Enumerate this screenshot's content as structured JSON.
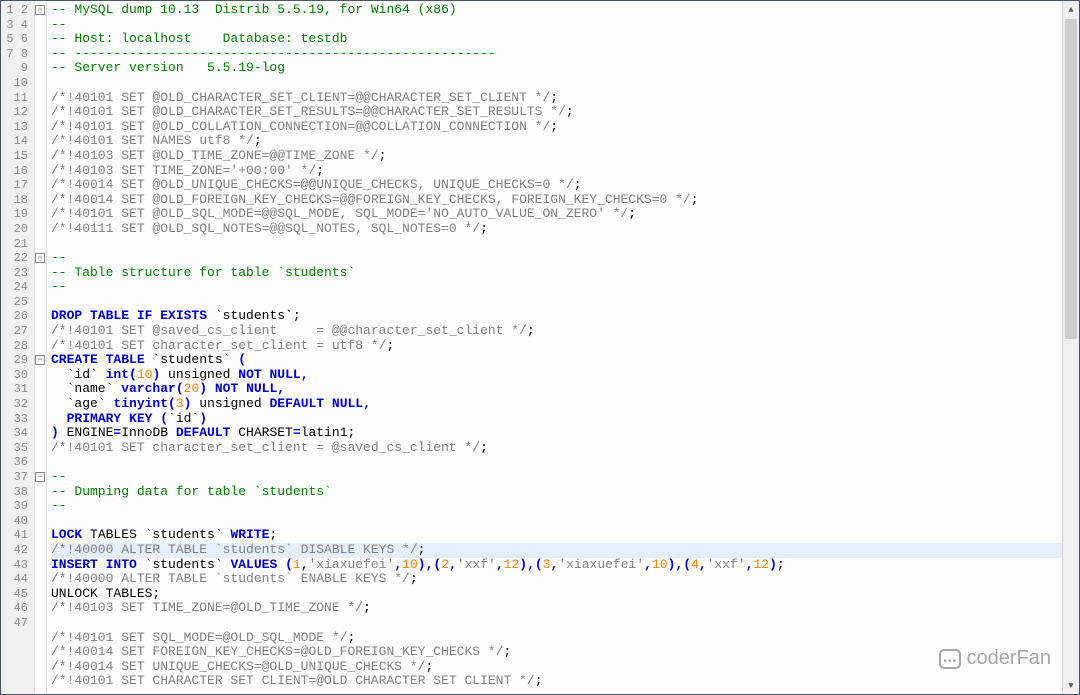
{
  "lineCount": 47,
  "highlightLine": 38,
  "foldMarks": [
    {
      "line": 1,
      "sym": "−"
    },
    {
      "line": 18,
      "sym": "−"
    },
    {
      "line": 25,
      "sym": "−"
    },
    {
      "line": 33,
      "sym": "−"
    }
  ],
  "watermark": "coderFan",
  "lines": {
    "l1": [
      [
        "c-comment",
        "-- MySQL dump 10.13  Distrib 5.5.19, for Win64 (x86)"
      ]
    ],
    "l2": [
      [
        "c-comment",
        "--"
      ]
    ],
    "l3": [
      [
        "c-comment",
        "-- Host: localhost    Database: testdb"
      ]
    ],
    "l4": [
      [
        "c-comment",
        "-- ------------------------------------------------------"
      ]
    ],
    "l5": [
      [
        "c-comment",
        "-- Server version   5.5.19-log"
      ]
    ],
    "l6": [
      [
        "",
        ""
      ]
    ],
    "l7": [
      [
        "c-gray",
        "/*!40101 SET @OLD_CHARACTER_SET_CLIENT=@@CHARACTER_SET_CLIENT */"
      ],
      [
        "c-black",
        ";"
      ]
    ],
    "l8": [
      [
        "c-gray",
        "/*!40101 SET @OLD_CHARACTER_SET_RESULTS=@@CHARACTER_SET_RESULTS */"
      ],
      [
        "c-black",
        ";"
      ]
    ],
    "l9": [
      [
        "c-gray",
        "/*!40101 SET @OLD_COLLATION_CONNECTION=@@COLLATION_CONNECTION */"
      ],
      [
        "c-black",
        ";"
      ]
    ],
    "l10": [
      [
        "c-gray",
        "/*!40101 SET NAMES utf8 */"
      ],
      [
        "c-black",
        ";"
      ]
    ],
    "l11": [
      [
        "c-gray",
        "/*!40103 SET @OLD_TIME_ZONE=@@TIME_ZONE */"
      ],
      [
        "c-black",
        ";"
      ]
    ],
    "l12": [
      [
        "c-gray",
        "/*!40103 SET TIME_ZONE='+00:00' */"
      ],
      [
        "c-black",
        ";"
      ]
    ],
    "l13": [
      [
        "c-gray",
        "/*!40014 SET @OLD_UNIQUE_CHECKS=@@UNIQUE_CHECKS, UNIQUE_CHECKS=0 */"
      ],
      [
        "c-black",
        ";"
      ]
    ],
    "l14": [
      [
        "c-gray",
        "/*!40014 SET @OLD_FOREIGN_KEY_CHECKS=@@FOREIGN_KEY_CHECKS, FOREIGN_KEY_CHECKS=0 */"
      ],
      [
        "c-black",
        ";"
      ]
    ],
    "l15": [
      [
        "c-gray",
        "/*!40101 SET @OLD_SQL_MODE=@@SQL_MODE, SQL_MODE='NO_AUTO_VALUE_ON_ZERO' */"
      ],
      [
        "c-black",
        ";"
      ]
    ],
    "l16": [
      [
        "c-gray",
        "/*!40111 SET @OLD_SQL_NOTES=@@SQL_NOTES, SQL_NOTES=0 */"
      ],
      [
        "c-black",
        ";"
      ]
    ],
    "l17": [
      [
        "",
        ""
      ]
    ],
    "l18": [
      [
        "c-comment",
        "--"
      ]
    ],
    "l19": [
      [
        "c-comment",
        "-- Table structure for table `students`"
      ]
    ],
    "l20": [
      [
        "c-comment",
        "--"
      ]
    ],
    "l21": [
      [
        "",
        ""
      ]
    ],
    "l22": [
      [
        "c-kw",
        "DROP TABLE IF EXISTS"
      ],
      [
        "c-black",
        " `students`;"
      ]
    ],
    "l23": [
      [
        "c-gray",
        "/*!40101 SET @saved_cs_client     = @@character_set_client */"
      ],
      [
        "c-black",
        ";"
      ]
    ],
    "l24": [
      [
        "c-gray",
        "/*!40101 SET character_set_client = utf8 */"
      ],
      [
        "c-black",
        ";"
      ]
    ],
    "l25": [
      [
        "c-kw",
        "CREATE TABLE"
      ],
      [
        "c-black",
        " `students` "
      ],
      [
        "c-kw",
        "("
      ]
    ],
    "l26": [
      [
        "c-black",
        "  `id` "
      ],
      [
        "c-kw",
        "int"
      ],
      [
        "c-kw",
        "("
      ],
      [
        "c-num",
        "10"
      ],
      [
        "c-kw",
        ")"
      ],
      [
        "c-black",
        " unsigned "
      ],
      [
        "c-kw",
        "NOT NULL"
      ],
      [
        "c-kw",
        ","
      ]
    ],
    "l27": [
      [
        "c-black",
        "  `name` "
      ],
      [
        "c-kw",
        "varchar"
      ],
      [
        "c-kw",
        "("
      ],
      [
        "c-num",
        "20"
      ],
      [
        "c-kw",
        ")"
      ],
      [
        "c-black",
        " "
      ],
      [
        "c-kw",
        "NOT NULL"
      ],
      [
        "c-kw",
        ","
      ]
    ],
    "l28": [
      [
        "c-black",
        "  `age` "
      ],
      [
        "c-kw",
        "tinyint"
      ],
      [
        "c-kw",
        "("
      ],
      [
        "c-num",
        "3"
      ],
      [
        "c-kw",
        ")"
      ],
      [
        "c-black",
        " unsigned "
      ],
      [
        "c-kw",
        "DEFAULT NULL"
      ],
      [
        "c-kw",
        ","
      ]
    ],
    "l29": [
      [
        "c-black",
        "  "
      ],
      [
        "c-kw",
        "PRIMARY KEY "
      ],
      [
        "c-kw",
        "("
      ],
      [
        "c-black",
        "`id`"
      ],
      [
        "c-kw",
        ")"
      ]
    ],
    "l30": [
      [
        "c-kw",
        ")"
      ],
      [
        "c-black",
        " ENGINE"
      ],
      [
        "c-kw",
        "="
      ],
      [
        "c-black",
        "InnoDB "
      ],
      [
        "c-kw",
        "DEFAULT"
      ],
      [
        "c-black",
        " CHARSET"
      ],
      [
        "c-kw",
        "="
      ],
      [
        "c-black",
        "latin1;"
      ]
    ],
    "l31": [
      [
        "c-gray",
        "/*!40101 SET character_set_client = @saved_cs_client */"
      ],
      [
        "c-black",
        ";"
      ]
    ],
    "l32": [
      [
        "",
        ""
      ]
    ],
    "l33": [
      [
        "c-comment",
        "--"
      ]
    ],
    "l34": [
      [
        "c-comment",
        "-- Dumping data for table `students`"
      ]
    ],
    "l35": [
      [
        "c-comment",
        "--"
      ]
    ],
    "l36": [
      [
        "",
        ""
      ]
    ],
    "l37": [
      [
        "c-kw",
        "LOCK"
      ],
      [
        "c-black",
        " TABLES `students` "
      ],
      [
        "c-kw",
        "WRITE"
      ],
      [
        "c-black",
        ";"
      ]
    ],
    "l38": [
      [
        "c-gray",
        "/*!40000 ALTER TABLE `students` DISABLE KEYS */"
      ],
      [
        "c-black",
        ";"
      ]
    ],
    "l39": [
      [
        "c-kw",
        "INSERT INTO"
      ],
      [
        "c-black",
        " `students` "
      ],
      [
        "c-kw",
        "VALUES "
      ],
      [
        "c-kw",
        "("
      ],
      [
        "c-num",
        "1"
      ],
      [
        "c-kw",
        ","
      ],
      [
        "c-str",
        "'xiaxuefei'"
      ],
      [
        "c-kw",
        ","
      ],
      [
        "c-num",
        "10"
      ],
      [
        "c-kw",
        ")"
      ],
      [
        "c-kw",
        ","
      ],
      [
        "c-kw",
        "("
      ],
      [
        "c-num",
        "2"
      ],
      [
        "c-kw",
        ","
      ],
      [
        "c-str",
        "'xxf'"
      ],
      [
        "c-kw",
        ","
      ],
      [
        "c-num",
        "12"
      ],
      [
        "c-kw",
        ")"
      ],
      [
        "c-kw",
        ","
      ],
      [
        "c-kw",
        "("
      ],
      [
        "c-num",
        "3"
      ],
      [
        "c-kw",
        ","
      ],
      [
        "c-str",
        "'xiaxuefei'"
      ],
      [
        "c-kw",
        ","
      ],
      [
        "c-num",
        "10"
      ],
      [
        "c-kw",
        ")"
      ],
      [
        "c-kw",
        ","
      ],
      [
        "c-kw",
        "("
      ],
      [
        "c-num",
        "4"
      ],
      [
        "c-kw",
        ","
      ],
      [
        "c-str",
        "'xxf'"
      ],
      [
        "c-kw",
        ","
      ],
      [
        "c-num",
        "12"
      ],
      [
        "c-kw",
        ")"
      ],
      [
        "c-black",
        ";"
      ]
    ],
    "l40": [
      [
        "c-gray",
        "/*!40000 ALTER TABLE `students` ENABLE KEYS */"
      ],
      [
        "c-black",
        ";"
      ]
    ],
    "l41": [
      [
        "c-black",
        "UNLOCK TABLES;"
      ]
    ],
    "l42": [
      [
        "c-gray",
        "/*!40103 SET TIME_ZONE=@OLD_TIME_ZONE */"
      ],
      [
        "c-black",
        ";"
      ]
    ],
    "l43": [
      [
        "",
        ""
      ]
    ],
    "l44": [
      [
        "c-gray",
        "/*!40101 SET SQL_MODE=@OLD_SQL_MODE */"
      ],
      [
        "c-black",
        ";"
      ]
    ],
    "l45": [
      [
        "c-gray",
        "/*!40014 SET FOREIGN_KEY_CHECKS=@OLD_FOREIGN_KEY_CHECKS */"
      ],
      [
        "c-black",
        ";"
      ]
    ],
    "l46": [
      [
        "c-gray",
        "/*!40014 SET UNIQUE_CHECKS=@OLD_UNIQUE_CHECKS */"
      ],
      [
        "c-black",
        ";"
      ]
    ],
    "l47": [
      [
        "c-gray",
        "/*!40101 SET CHARACTER SET CLIENT=@OLD CHARACTER SET CLIENT */"
      ],
      [
        "c-black",
        ";"
      ]
    ]
  }
}
